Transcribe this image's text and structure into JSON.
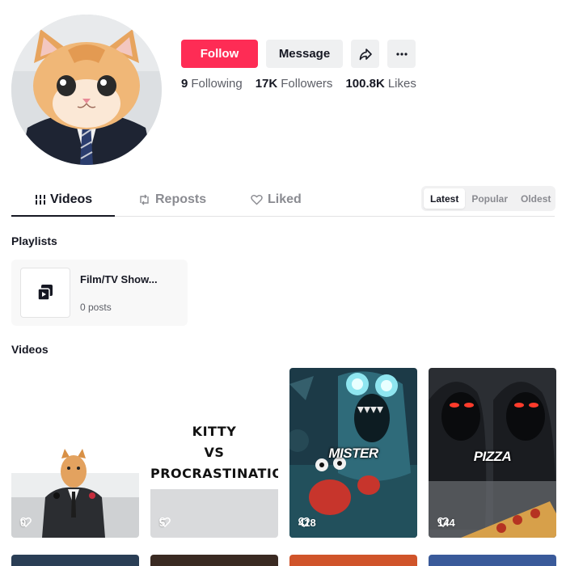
{
  "profile": {
    "follow_label": "Follow",
    "message_label": "Message",
    "stats": [
      {
        "num": "9",
        "label": "Following"
      },
      {
        "num": "17K",
        "label": "Followers"
      },
      {
        "num": "100.8K",
        "label": "Likes"
      }
    ]
  },
  "tabs": [
    {
      "label": "Videos",
      "icon": "grid-icon",
      "active": true
    },
    {
      "label": "Reposts",
      "icon": "repost-icon",
      "active": false
    },
    {
      "label": "Liked",
      "icon": "heart-lock-icon",
      "active": false
    }
  ],
  "sort": [
    {
      "label": "Latest",
      "active": true
    },
    {
      "label": "Popular",
      "active": false
    },
    {
      "label": "Oldest",
      "active": false
    }
  ],
  "playlists_title": "Playlists",
  "playlist": {
    "title": "Film/TV Show...",
    "posts": "0 posts"
  },
  "videos_title": "Videos",
  "videos": [
    {
      "views": "0"
    },
    {
      "views": "5",
      "text_lines": [
        "KITTY",
        "VS",
        "PROCRASTINATION"
      ]
    },
    {
      "views": "418",
      "overlay": "MISTER"
    },
    {
      "views": "144",
      "overlay": "PIZZA"
    }
  ],
  "colors": {
    "accent": "#fe2c55",
    "text": "#161823",
    "secondary": "#5c5e66",
    "button_bg": "#eff0f1"
  }
}
